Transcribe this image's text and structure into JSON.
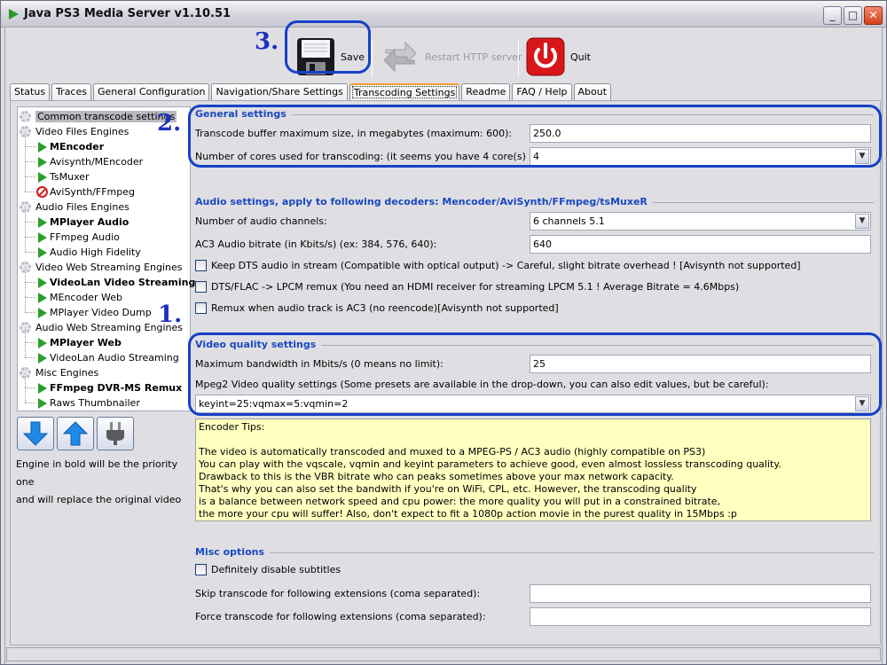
{
  "window": {
    "title": "Java PS3 Media Server v1.10.51",
    "minimize": "_",
    "maximize": "□",
    "close": "✕"
  },
  "toolbar": {
    "save_label": "Save",
    "restart_label": "Restart HTTP server",
    "quit_label": "Quit",
    "save_icon": "floppy-disk-icon",
    "restart_icon": "restart-arrows-icon",
    "quit_icon": "power-icon"
  },
  "annotations": {
    "one": "1.",
    "two": "2.",
    "three": "3.",
    "ring_color": "#1641c8"
  },
  "tabs": [
    {
      "label": "Status"
    },
    {
      "label": "Traces"
    },
    {
      "label": "General Configuration"
    },
    {
      "label": "Navigation/Share Settings"
    },
    {
      "label": "Transcoding Settings",
      "active": true
    },
    {
      "label": "Readme"
    },
    {
      "label": "FAQ / Help"
    },
    {
      "label": "About"
    }
  ],
  "tree": [
    {
      "type": "cat",
      "label": "Common transcode settings",
      "selected": true
    },
    {
      "type": "cat",
      "label": "Video Files Engines"
    },
    {
      "type": "eng",
      "label": "MEncoder",
      "bold": true
    },
    {
      "type": "eng",
      "label": "Avisynth/MEncoder"
    },
    {
      "type": "eng",
      "label": "TsMuxer"
    },
    {
      "type": "eng",
      "label": "AviSynth/FFmpeg",
      "disabled": true
    },
    {
      "type": "cat",
      "label": "Audio Files Engines"
    },
    {
      "type": "eng",
      "label": "MPlayer Audio",
      "bold": true
    },
    {
      "type": "eng",
      "label": "FFmpeg Audio"
    },
    {
      "type": "eng",
      "label": "Audio High Fidelity"
    },
    {
      "type": "cat",
      "label": "Video Web Streaming Engines"
    },
    {
      "type": "eng",
      "label": "VideoLan Video Streaming",
      "bold": true
    },
    {
      "type": "eng",
      "label": "MEncoder Web"
    },
    {
      "type": "eng",
      "label": "MPlayer Video Dump"
    },
    {
      "type": "cat",
      "label": "Audio Web Streaming Engines"
    },
    {
      "type": "eng",
      "label": "MPlayer Web",
      "bold": true
    },
    {
      "type": "eng",
      "label": "VideoLan Audio Streaming"
    },
    {
      "type": "cat",
      "label": "Misc Engines"
    },
    {
      "type": "eng",
      "label": "FFmpeg DVR-MS Remux",
      "bold": true
    },
    {
      "type": "eng",
      "label": "Raws Thumbnailer"
    }
  ],
  "tree_buttons": {
    "down": "arrow-down-icon",
    "up": "arrow-up-icon",
    "toggle": "plug-icon"
  },
  "hint": {
    "line1": "Engine in bold will be the priority one",
    "line2": "and will replace the original video"
  },
  "general": {
    "heading": "General settings",
    "buffer_label": "Transcode buffer maximum size, in megabytes (maximum: 600):",
    "buffer_value": "250.0",
    "cores_label": "Number of cores used for transcoding: (it seems you have 4 core(s) available)",
    "cores_value": "4"
  },
  "audio": {
    "heading": "Audio settings, apply to following decoders: Mencoder/AviSynth/FFmpeg/tsMuxeR",
    "channels_label": "Number of audio channels:",
    "channels_value": "6 channels 5.1",
    "ac3_label": "AC3 Audio bitrate (in Kbits/s) (ex: 384, 576, 640):",
    "ac3_value": "640",
    "checkboxes": [
      {
        "label": "Keep DTS audio in stream (Compatible with optical output) -> Careful, slight bitrate overhead ! [Avisynth not supported]",
        "checked": false
      },
      {
        "label": "DTS/FLAC -> LPCM remux (You need an HDMI receiver for streaming LPCM 5.1 ! Average Bitrate = 4.6Mbps)",
        "checked": false
      },
      {
        "label": "Remux when audio track is AC3 (no reencode)[Avisynth not supported]",
        "checked": false
      }
    ]
  },
  "video": {
    "heading": "Video quality settings",
    "bandwidth_label": "Maximum bandwidth in Mbits/s (0 means no limit):",
    "bandwidth_value": "25",
    "mpeg2_label": "Mpeg2 Video quality settings (Some presets are available in the drop-down, you can also edit values, but be careful):",
    "mpeg2_value": "keyint=25:vqmax=5:vqmin=2",
    "tips": "Encoder Tips:\n\nThe video is automatically transcoded and muxed to a MPEG-PS / AC3 audio (highly compatible on PS3)\nYou can play with the vqscale, vqmin and keyint parameters to achieve good, even almost lossless transcoding quality.\nDrawback to this is the VBR bitrate who can peaks sometimes above your max network capacity.\nThat's why you can also set the bandwith if you're on WiFi, CPL, etc. However, the transcoding quality\nis a balance between network speed and cpu power: the more quality you will put in a constrained bitrate,\nthe more your cpu will suffer! Also, don't expect to fit a 1080p action movie in the purest quality in 15Mbps :p"
  },
  "misc": {
    "heading": "Misc options",
    "disable_subs_label": "Definitely disable subtitles",
    "disable_subs_checked": false,
    "skip_label": "Skip transcode for following extensions (coma separated):",
    "skip_value": "",
    "force_label": "Force transcode for following extensions (coma separated):",
    "force_value": ""
  }
}
